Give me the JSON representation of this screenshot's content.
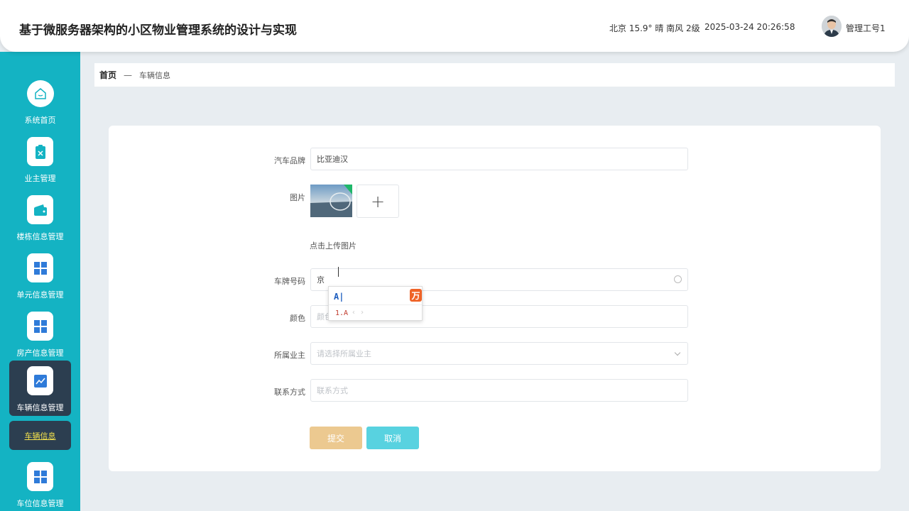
{
  "header": {
    "title": "基于微服务器架构的小区物业管理系统的设计与实现",
    "weather": "北京  15.9°  晴  南风  2级",
    "datetime": "2025-03-24 20:26:58",
    "user": "管理工号1"
  },
  "sidebar": {
    "items": [
      {
        "label": "系统首页",
        "icon": "home-icon"
      },
      {
        "label": "业主管理",
        "icon": "clipboard-icon"
      },
      {
        "label": "楼栋信息管理",
        "icon": "wallet-icon"
      },
      {
        "label": "单元信息管理",
        "icon": "grid-icon"
      },
      {
        "label": "房产信息管理",
        "icon": "grid-icon"
      },
      {
        "label": "车辆信息管理",
        "icon": "chart-icon"
      },
      {
        "label": "车位信息管理",
        "icon": "grid-icon"
      }
    ],
    "sub_item": "车辆信息"
  },
  "breadcrumb": {
    "home": "首页",
    "separator": "—",
    "current": "车辆信息"
  },
  "form": {
    "brand_label": "汽车品牌",
    "brand_value": "比亚迪汉",
    "image_label": "图片",
    "upload_plus": "+",
    "upload_hint": "点击上传图片",
    "plate_label": "车牌号码",
    "plate_value": "京",
    "color_label": "颜色",
    "color_placeholder": "颜色",
    "owner_label": "所属业主",
    "owner_placeholder": "请选择所属业主",
    "contact_label": "联系方式",
    "contact_placeholder": "联系方式",
    "submit": "提交",
    "cancel": "取消"
  },
  "ime": {
    "input": "A|",
    "logo": "万",
    "candidate": "1.A",
    "arrows": "‹ ›"
  },
  "colors": {
    "sidebar": "#14b3c3",
    "active": "#2c3e50",
    "submit": "#ecc990",
    "cancel": "#58d2e0"
  }
}
